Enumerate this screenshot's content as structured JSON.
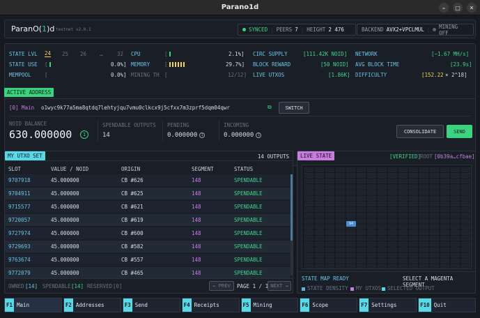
{
  "window": {
    "title": "Parano1d"
  },
  "header": {
    "brand_pre": "ParanO(",
    "brand_mid": "1",
    "brand_post": ")d",
    "network": "testnet v2.0.1",
    "sync_status": "SYNCED",
    "peers_label": "PEERS",
    "peers": "7",
    "height_label": "HEIGHT",
    "height": "2 476",
    "backend_label": "BACKEND",
    "backend": "AVX2+VPCLMUL",
    "mining": "MINING OFF"
  },
  "stats": {
    "state_lvl_label": "STATE LVL",
    "state_lvls": [
      "24",
      "25",
      "26",
      "…",
      "32"
    ],
    "state_use_label": "STATE USE",
    "state_use_bar": "[",
    "state_use_pct": "0.0%]",
    "mempool_label": "MEMPOOL",
    "mempool_bar": "[",
    "mempool_pct": "0.0%]",
    "cpu_label": "CPU",
    "cpu_bar": "[",
    "cpu_pct": "2.1%]",
    "memory_label": "MEMORY",
    "memory_bar": "[",
    "memory_pct": "29.7%]",
    "mining_label": "MINING TH",
    "mining_bar": "[",
    "mining_val": "12/12]",
    "circ_label": "CIRC SUPPLY",
    "circ_val": "[111.42K NOID]",
    "reward_label": "BLOCK REWARD",
    "reward_val": "[50 NOID]",
    "utxos_label": "LIVE UTXOS",
    "utxos_val": "[1.86K]",
    "network_label": "NETWORK",
    "network_val": "[~1.67 MH/s]",
    "blocktime_label": "AVG BLOCK TIME",
    "blocktime_val": "[23.9s]",
    "difficulty_label": "DIFFICULTY",
    "difficulty_val": "[152.22",
    "difficulty_exp": "× 2^18]"
  },
  "address": {
    "tag": "ACTIVE ADDRESS",
    "index": "[0] Main",
    "value": "o1wyc9k77a5ma8qtdq7lehtyjqu7vmu0clkcx9j5cfxx7m3zprf5dqm04qwr",
    "switch_label": "SWITCH",
    "balance_label": "NOID BALANCE",
    "balance": "630.000000",
    "spendable_label": "SPENDABLE OUTPUTS",
    "spendable": "14",
    "pending_label": "PENDING",
    "pending": "0.000000",
    "incoming_label": "INCOMING",
    "incoming": "0.000000",
    "consolidate_label": "CONSOLIDATE",
    "send_label": "SEND"
  },
  "utxo": {
    "tag": "MY UTXO SET",
    "count": "14 OUTPUTS",
    "columns": [
      "SLOT",
      "VALUE / NOID",
      "ORIGIN",
      "SEGMENT",
      "STATUS"
    ],
    "rows": [
      [
        "9707918",
        "45.000000",
        "CB #626",
        "148",
        "SPENDABLE"
      ],
      [
        "9704911",
        "45.000000",
        "CB #625",
        "148",
        "SPENDABLE"
      ],
      [
        "9715577",
        "45.000000",
        "CB #621",
        "148",
        "SPENDABLE"
      ],
      [
        "9720057",
        "45.000000",
        "CB #619",
        "148",
        "SPENDABLE"
      ],
      [
        "9727974",
        "45.000000",
        "CB #600",
        "148",
        "SPENDABLE"
      ],
      [
        "9729693",
        "45.000000",
        "CB #582",
        "148",
        "SPENDABLE"
      ],
      [
        "9763674",
        "45.000000",
        "CB #557",
        "148",
        "SPENDABLE"
      ],
      [
        "9772079",
        "45.000000",
        "CB #465",
        "148",
        "SPENDABLE"
      ]
    ],
    "owned_label": "OWNED",
    "owned": "[14]",
    "spendable_label": "SPENDABLE",
    "spendable": "[14]",
    "reserved_label": "RESERVED",
    "reserved": "[0]",
    "prev_label": "← PREV",
    "page_label": "PAGE 1 / 1",
    "next_label": "NEXT →"
  },
  "live": {
    "tag": "LIVE STATE",
    "verified": "[VERIFIED]",
    "root_label": "ROOT",
    "root": "[0b39a…cfbae]",
    "marker": "94",
    "status": "STATE MAP READY",
    "hint": "SELECT A MAGENTA SEGMENT",
    "legend": [
      "STATE DENSITY",
      "MY UTXOS",
      "SELECTED OUTPUT"
    ],
    "legend_colors": [
      "#5ab4d6",
      "#c77dde",
      "#5ad8e6"
    ]
  },
  "fkeys": [
    {
      "key": "F1",
      "label": "Main"
    },
    {
      "key": "F2",
      "label": "Addresses"
    },
    {
      "key": "F3",
      "label": "Send"
    },
    {
      "key": "F4",
      "label": "Receipts"
    },
    {
      "key": "F5",
      "label": "Mining"
    },
    {
      "key": "F6",
      "label": "Scope"
    },
    {
      "key": "F7",
      "label": "Settings"
    },
    {
      "key": "F10",
      "label": "Quit"
    }
  ]
}
